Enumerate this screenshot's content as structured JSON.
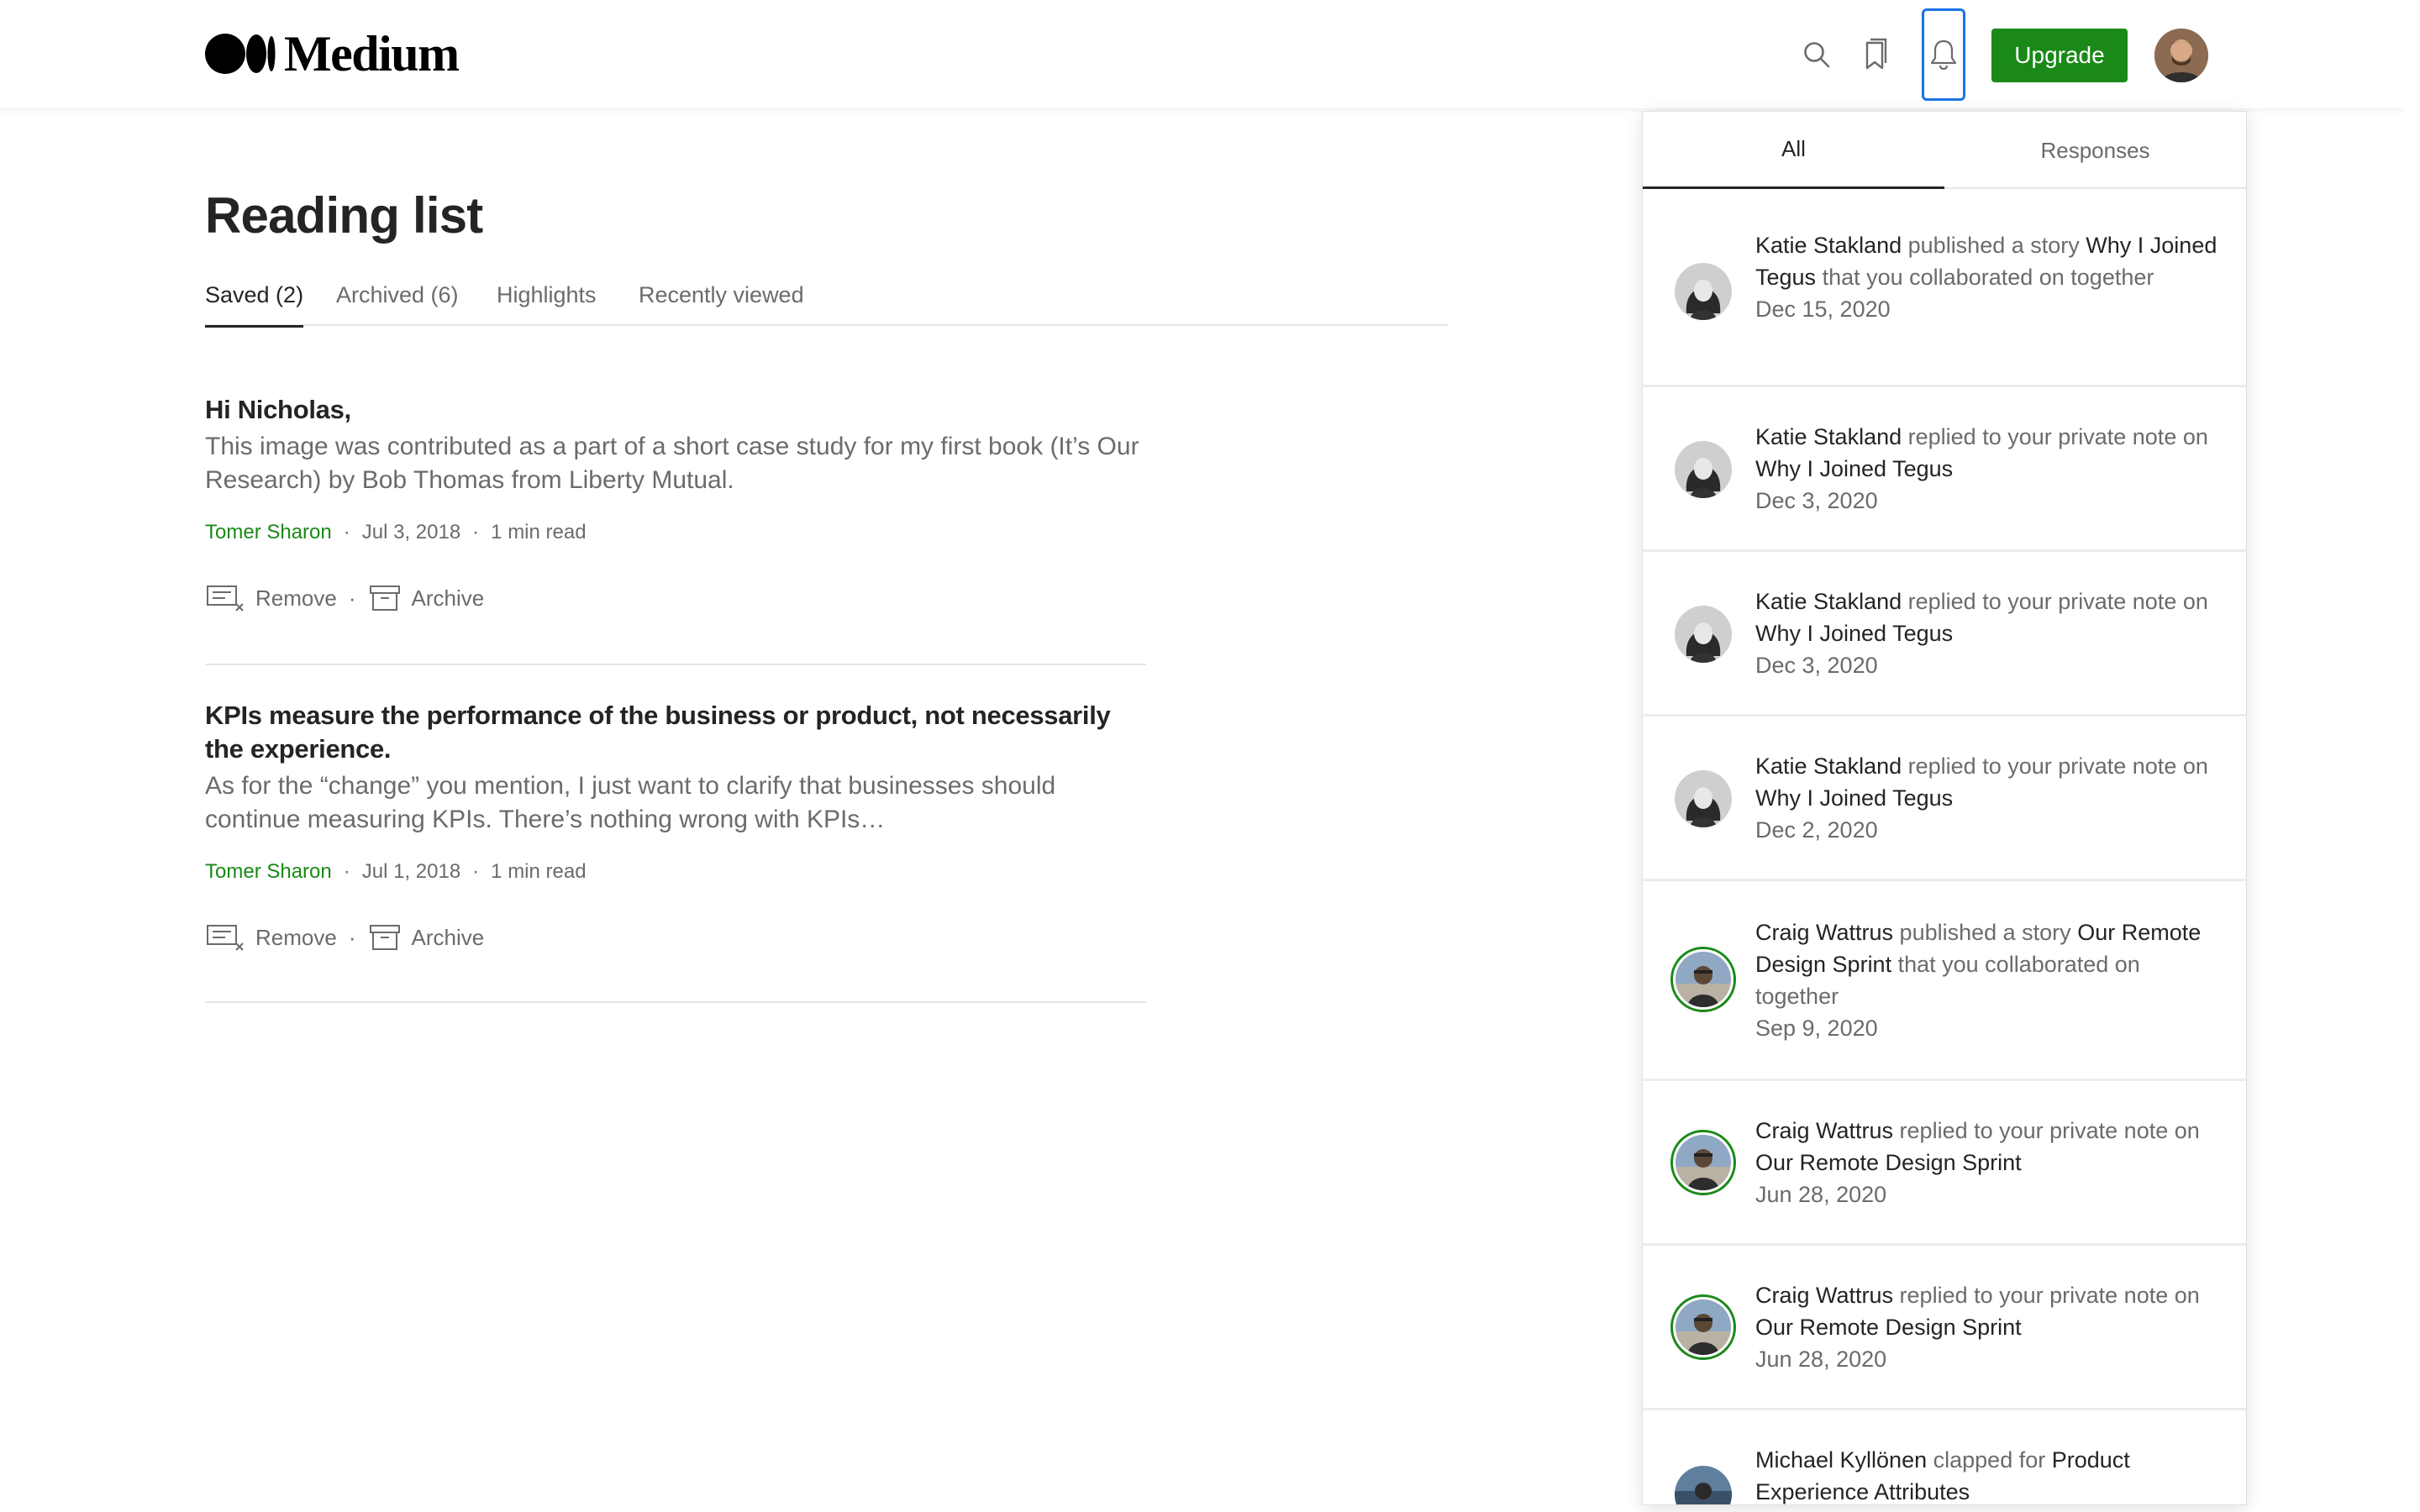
{
  "header": {
    "logo_text": "Medium",
    "upgrade_label": "Upgrade",
    "icons": [
      "search-icon",
      "bookmarks-icon",
      "bell-icon"
    ],
    "accent_color": "#1a8917"
  },
  "main": {
    "title": "Reading list",
    "tabs": [
      {
        "label": "Saved (2)",
        "active": true
      },
      {
        "label": "Archived (6)",
        "active": false
      },
      {
        "label": "Highlights",
        "active": false
      },
      {
        "label": "Recently viewed",
        "active": false
      }
    ],
    "articles": [
      {
        "title": "Hi Nicholas,",
        "snippet": "This image was contributed as a part of a short case study for my first book (It’s Our Research) by Bob Thomas from Liberty Mutual.",
        "author": "Tomer Sharon",
        "date": "Jul 3, 2018",
        "read_time": "1 min read",
        "remove_label": "Remove",
        "archive_label": "Archive"
      },
      {
        "title": "KPIs measure the performance of the business or product, not necessarily the experience.",
        "snippet": "As for the “change” you mention, I just want to clarify that businesses should continue measuring KPIs. There’s nothing wrong with KPIs…",
        "author": "Tomer Sharon",
        "date": "Jul 1, 2018",
        "read_time": "1 min read",
        "remove_label": "Remove",
        "archive_label": "Archive"
      }
    ],
    "separator": "·"
  },
  "notifications": {
    "tabs": [
      {
        "label": "All",
        "active": true
      },
      {
        "label": "Responses",
        "active": false
      }
    ],
    "items": [
      {
        "who": "Katie Stakland",
        "action": "published a story",
        "what": "Why I Joined Tegus",
        "tail": "that you collaborated on together",
        "date": "Dec 15, 2020"
      },
      {
        "who": "Katie Stakland",
        "action": "replied to your private note on",
        "what": "Why I Joined Tegus",
        "tail": "",
        "date": "Dec 3, 2020"
      },
      {
        "who": "Katie Stakland",
        "action": "replied to your private note on",
        "what": "Why I Joined Tegus",
        "tail": "",
        "date": "Dec 3, 2020"
      },
      {
        "who": "Katie Stakland",
        "action": "replied to your private note on",
        "what": "Why I Joined Tegus",
        "tail": "",
        "date": "Dec 2, 2020"
      },
      {
        "who": "Craig Wattrus",
        "action": "published a story",
        "what": "Our Remote Design Sprint",
        "tail": "that you collaborated on together",
        "date": "Sep 9, 2020"
      },
      {
        "who": "Craig Wattrus",
        "action": "replied to your private note on",
        "what": "Our Remote Design Sprint",
        "tail": "",
        "date": "Jun 28, 2020"
      },
      {
        "who": "Craig Wattrus",
        "action": "replied to your private note on",
        "what": "Our Remote Design Sprint",
        "tail": "",
        "date": "Jun 28, 2020"
      },
      {
        "who": "Michael Kyllönen",
        "action": "clapped for",
        "what": "Product Experience Attributes",
        "tail": "",
        "date": ""
      }
    ]
  }
}
